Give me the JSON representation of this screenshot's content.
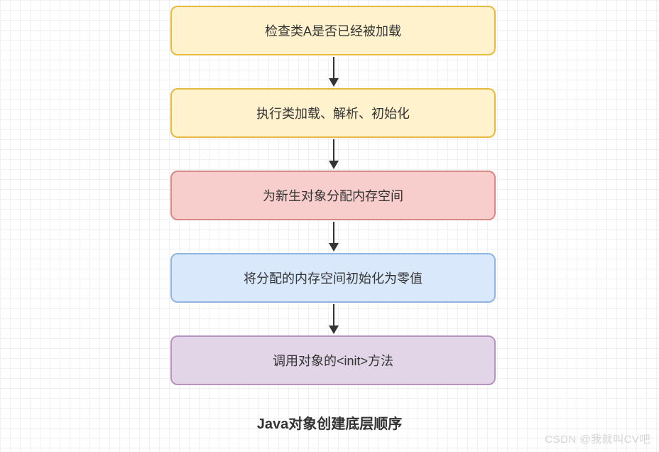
{
  "flowchart": {
    "nodes": [
      {
        "label": "检查类A是否已经被加载"
      },
      {
        "label": "执行类加载、解析、初始化"
      },
      {
        "label": "为新生对象分配内存空间"
      },
      {
        "label": "将分配的内存空间初始化为零值"
      },
      {
        "label": "调用对象的<init>方法"
      }
    ],
    "title": "Java对象创建底层顺序"
  },
  "watermark": "CSDN @我就叫CV吧"
}
